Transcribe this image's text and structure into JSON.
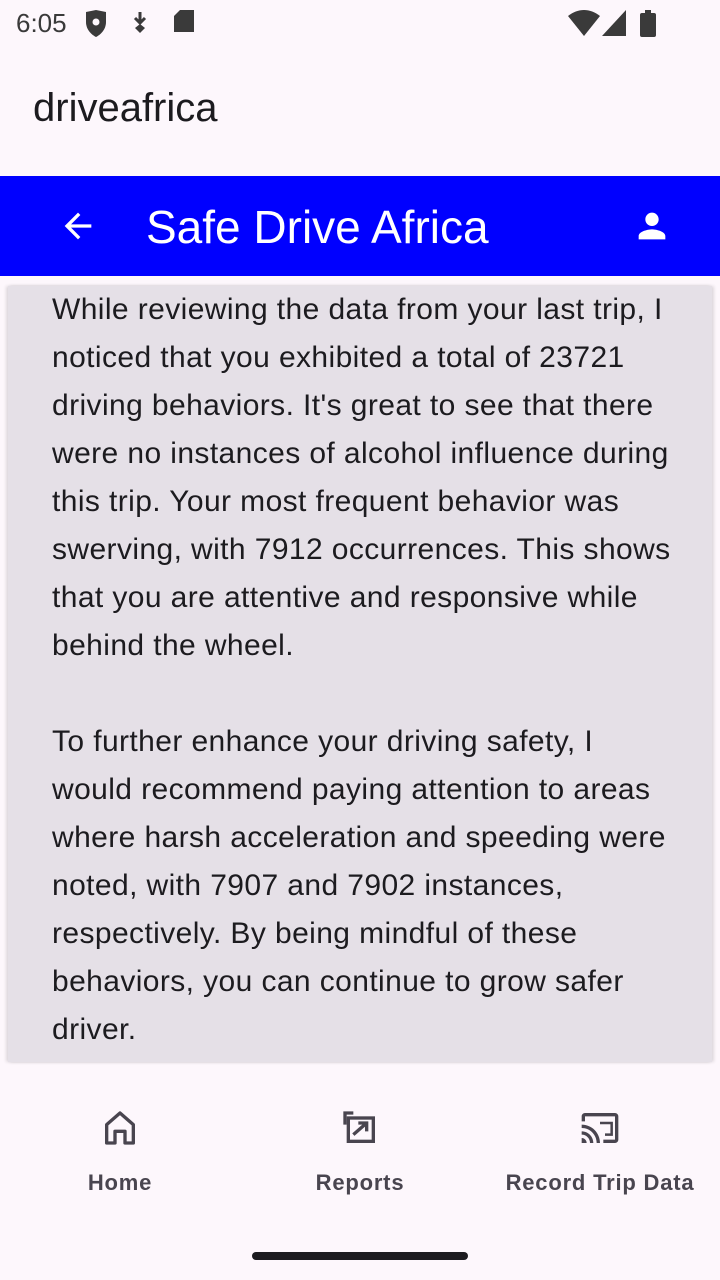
{
  "status_bar": {
    "time": "6:05",
    "icons": [
      "shield-icon",
      "download-icon",
      "sd-card-icon",
      "wifi-icon",
      "signal-icon",
      "battery-icon"
    ]
  },
  "app": {
    "title": "driveafrica"
  },
  "top_bar": {
    "title": "Safe Drive Africa",
    "background": "#0000FF",
    "back_icon": "arrow-back-icon",
    "profile_icon": "person-icon"
  },
  "report": {
    "paragraph_1": "While reviewing the data from your last trip, I noticed that you exhibited a total of 23721 driving behaviors. It's great to see that there were no instances of alcohol influence during this trip. Your most frequent behavior was swerving, with 7912 occurrences. This shows that you are attentive and responsive while behind the wheel.",
    "paragraph_2": "To further enhance your driving safety, I would recommend paying attention to areas where harsh acceleration and speeding were noted, with 7907 and 7902 instances, respectively. By being mindful of these behaviors, you can continue to grow safer driver."
  },
  "bottom_nav": {
    "items": [
      {
        "label": "Home",
        "icon": "home-icon"
      },
      {
        "label": "Reports",
        "icon": "reports-icon"
      },
      {
        "label": "Record Trip Data",
        "icon": "cast-icon"
      }
    ]
  }
}
